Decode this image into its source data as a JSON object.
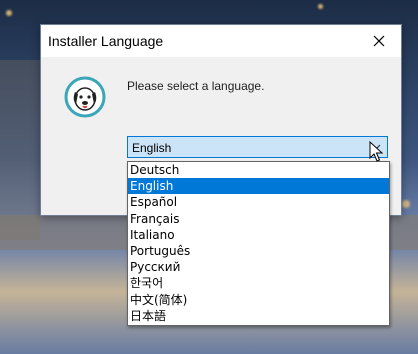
{
  "dialog": {
    "title": "Installer Language",
    "close_icon": "close-icon",
    "app_icon": "dog-mascot-icon",
    "prompt": "Please select a language."
  },
  "language_select": {
    "selected_value": "English",
    "arrow_icon": "chevron-down-icon",
    "options": [
      {
        "label": "Deutsch",
        "selected": false
      },
      {
        "label": "English",
        "selected": true
      },
      {
        "label": "Español",
        "selected": false
      },
      {
        "label": "Français",
        "selected": false
      },
      {
        "label": "Italiano",
        "selected": false
      },
      {
        "label": "Português",
        "selected": false
      },
      {
        "label": "Русский",
        "selected": false
      },
      {
        "label": "한국어",
        "selected": false
      },
      {
        "label": "中文(简体)",
        "selected": false
      },
      {
        "label": "日本語",
        "selected": false
      }
    ]
  },
  "colors": {
    "accent": "#0078d7",
    "combo_background": "#cce4f7",
    "icon_ring": "#3aa6b8"
  }
}
